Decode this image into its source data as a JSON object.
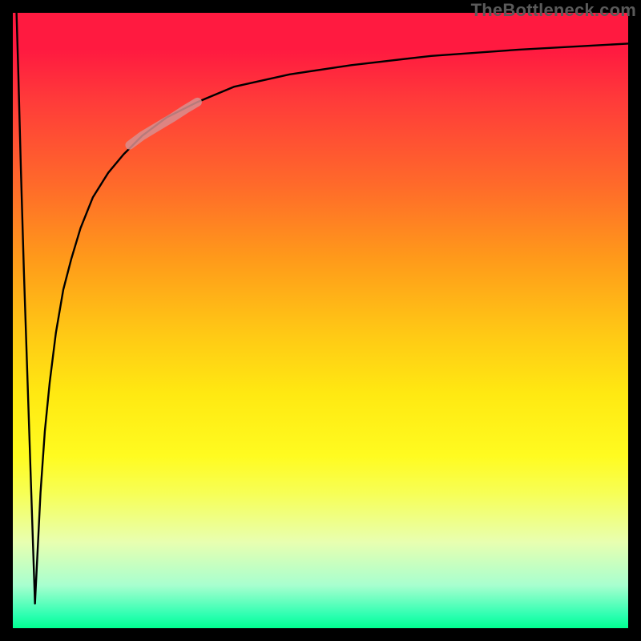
{
  "watermark": "TheBottleneck.com",
  "colors": {
    "curve": "#000000",
    "highlight": "#d88f8f",
    "frame": "#000000"
  },
  "chart_data": {
    "type": "line",
    "title": "",
    "xlabel": "",
    "ylabel": "",
    "xlim": [
      0,
      100
    ],
    "ylim": [
      0,
      100
    ],
    "grid": false,
    "legend": false,
    "annotations": [],
    "notes": "Mapping: x_px = x/100*768, y_px = (100 - y)/100*768. y-value is percent of chart height from the bottom (higher = closer to top). Left branch drops from top-left to a sharp near-bottom dip around x≈3.6, right branch rises and asymptotes near y≈95.",
    "series": [
      {
        "name": "left-branch",
        "x": [
          0.6,
          0.9,
          1.3,
          1.8,
          2.4,
          3.0,
          3.4,
          3.6
        ],
        "y": [
          100,
          90,
          75,
          58,
          40,
          22,
          10,
          4
        ]
      },
      {
        "name": "right-branch",
        "x": [
          3.6,
          4.0,
          4.5,
          5.2,
          6.0,
          7.0,
          8.2,
          9.5,
          11.0,
          13.0,
          15.5,
          18.0,
          21.0,
          25.0,
          30.0,
          36.0,
          45.0,
          55.0,
          68.0,
          82.0,
          100.0
        ],
        "y": [
          4,
          12,
          22,
          32,
          40,
          48,
          55,
          60,
          65,
          70,
          74,
          77,
          80,
          83,
          85.5,
          88,
          90,
          91.5,
          93,
          94,
          95
        ]
      }
    ],
    "highlight_segment": {
      "series": "right-branch",
      "x_range": [
        19,
        30
      ],
      "approx_points": {
        "x": [
          19,
          21,
          23.5,
          26,
          28,
          30
        ],
        "y": [
          78.5,
          80,
          81.5,
          83,
          84.3,
          85.5
        ]
      }
    }
  }
}
